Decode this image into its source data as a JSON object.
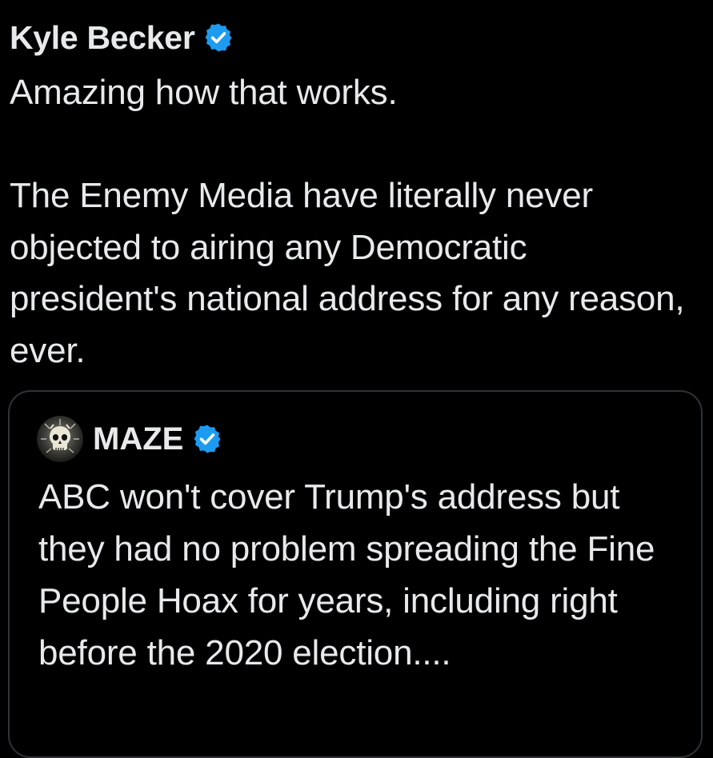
{
  "post": {
    "author": {
      "name": "Kyle Becker",
      "verified": true,
      "verified_icon": "verified-badge-icon"
    },
    "text": "Amazing how that works.\n\nThe Enemy Media have literally never objected to airing any Democratic president's national address for any reason, ever."
  },
  "quoted_post": {
    "author": {
      "name": "MAZE",
      "verified": true,
      "verified_icon": "verified-badge-icon",
      "avatar_icon": "skull-avatar-icon"
    },
    "text": "ABC won't cover Trump's address but they had no problem spreading the Fine People Hoax for years, including right before the 2020 election...."
  },
  "colors": {
    "background": "#000000",
    "text": "#e7e9ea",
    "verified_blue": "#1d9bf0",
    "card_border": "#2f3336"
  }
}
